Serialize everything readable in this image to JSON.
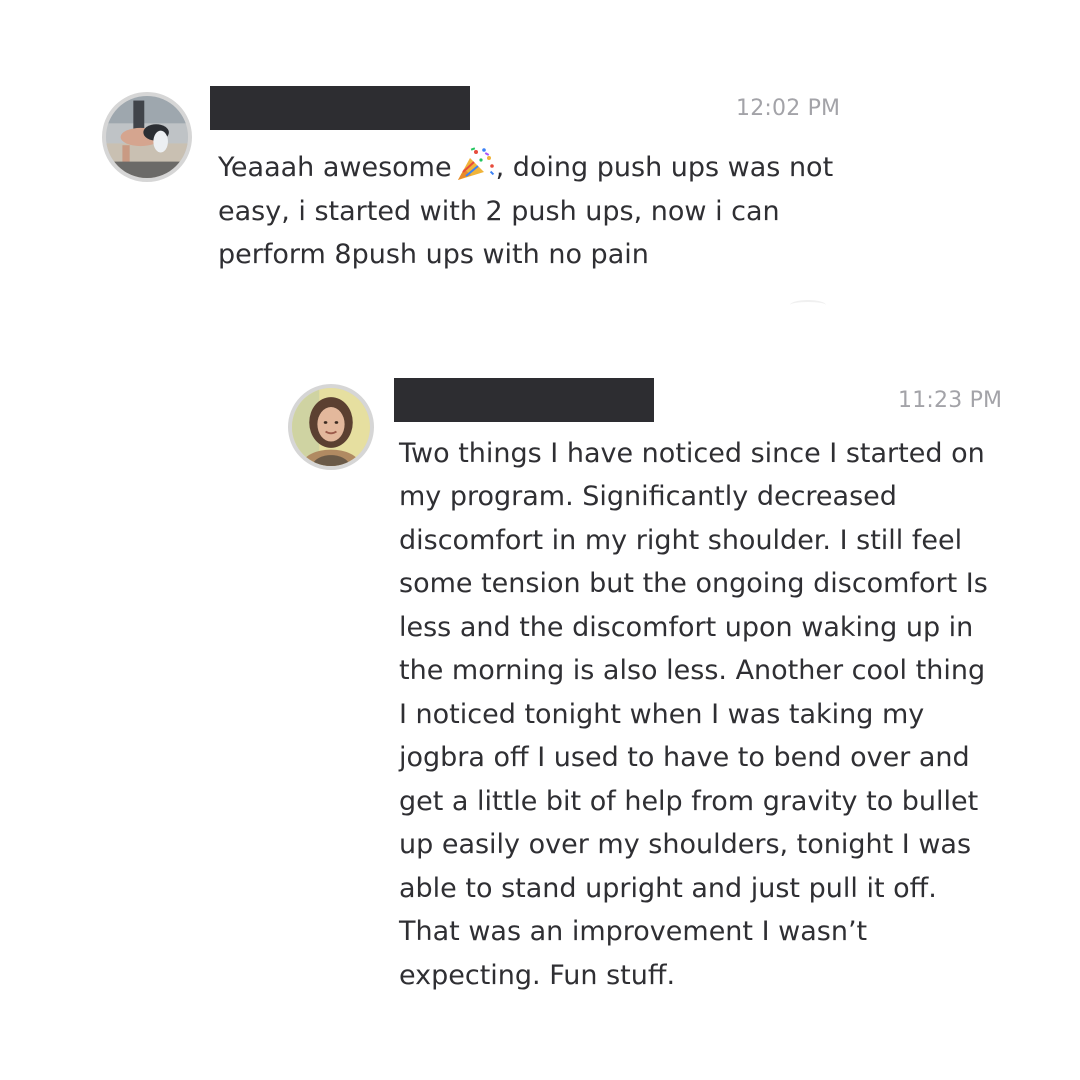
{
  "messages": [
    {
      "timestamp": "12:02 PM",
      "text_before_emoji": "Yeaaah awesome",
      "emoji": "party-popper",
      "text_after_emoji": ", doing push ups was not easy, i started with 2 push ups, now i can perform 8push ups with no pain"
    },
    {
      "timestamp": "11:23 PM",
      "text": "Two things I have noticed since I started on my program. Significantly decreased discomfort in my right shoulder. I still feel some tension but the ongoing discomfort Is less and the discomfort upon waking up in the morning is also less. Another cool thing I noticed tonight when I was taking my jogbra off I used to have to bend over and get a little bit of help from gravity to bullet up easily over my shoulders, tonight I was able to stand upright and just pull it off. That was an improvement I wasn’t expecting. Fun stuff."
    }
  ],
  "colors": {
    "text": "#2f2f33",
    "timestamp": "#a3a3a8",
    "redaction": "#2d2d31",
    "avatar_border": "#d6d6d6",
    "background": "#ffffff"
  }
}
